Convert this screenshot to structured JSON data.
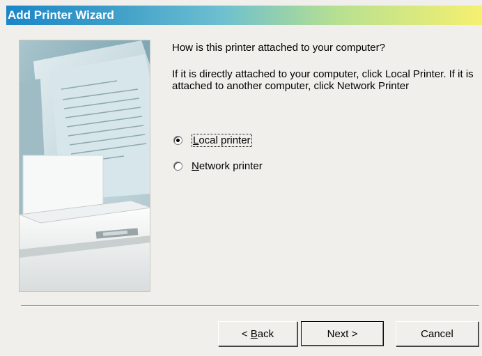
{
  "window": {
    "title": "Add Printer Wizard"
  },
  "main": {
    "question": "How is this printer attached to your computer?",
    "info": "If it is directly attached to your computer, click Local Printer. If it is attached to another computer, click Network Printer",
    "options": [
      {
        "label": "Local printer",
        "mnemonic": "L",
        "rest": "ocal printer",
        "checked": true
      },
      {
        "label": "Network printer",
        "mnemonic": "N",
        "rest": "etwork printer",
        "checked": false
      }
    ]
  },
  "buttons": {
    "back": {
      "prefix": "< ",
      "mnemonic": "B",
      "rest": "ack"
    },
    "next": "Next >",
    "cancel": "Cancel"
  },
  "image": {
    "icon": "printer-paper-illustration"
  }
}
